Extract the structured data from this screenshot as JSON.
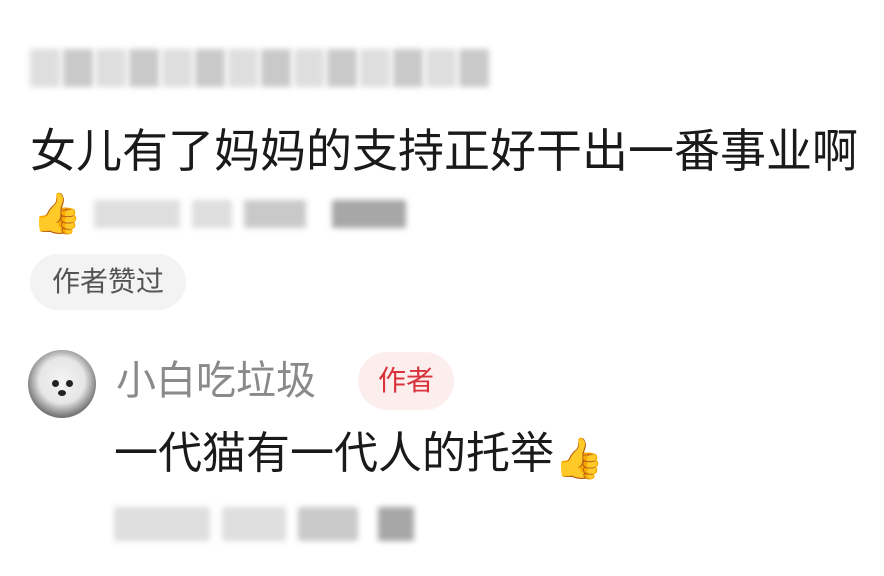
{
  "comment": {
    "text": "女儿有了妈妈的支持正好干出一番事业啊",
    "like_icon": "thumbs-up",
    "liked_by_author_label": "作者赞过"
  },
  "reply": {
    "username": "小白吃垃圾",
    "author_tag": "作者",
    "text": "一代猫有一代人的托举",
    "text_emoji": "👍"
  },
  "colors": {
    "author_tag_text": "#d9323b",
    "author_tag_bg": "#fdeeee",
    "badge_bg": "#f3f3f3",
    "username_gray": "#8a8a8a",
    "body_text": "#1a1a1a"
  }
}
